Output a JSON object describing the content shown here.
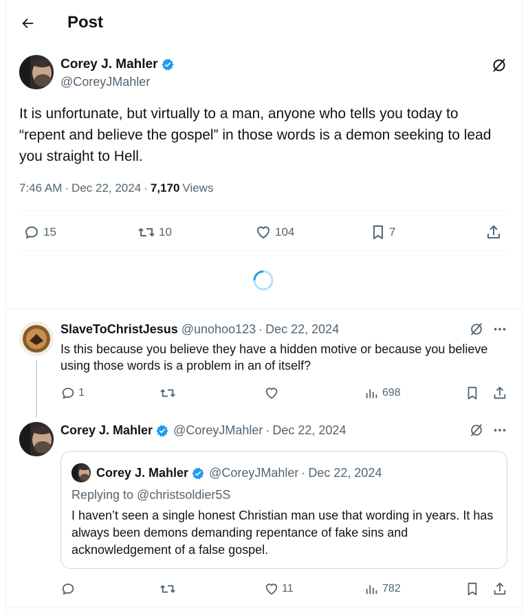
{
  "header": {
    "title": "Post"
  },
  "main_post": {
    "author": {
      "name": "Corey J. Mahler",
      "handle": "@CoreyJMahler"
    },
    "text": "It is unfortunate, but virtually to a man, anyone who tells you today to “repent and believe the gospel” in those words is a demon seeking to lead you straight to Hell.",
    "time": "7:46 AM",
    "date": "Dec 22, 2024",
    "views_count": "7,170",
    "views_label": "Views",
    "stats": {
      "replies": "15",
      "reposts": "10",
      "likes": "104",
      "bookmarks": "7"
    }
  },
  "reply1": {
    "author": {
      "name": "SlaveToChristJesus",
      "handle": "@unohoo123"
    },
    "date": "Dec 22, 2024",
    "text": "Is this because you believe they have a hidden motive or because you believe using those words is a problem in an of itself?",
    "stats": {
      "replies": "1",
      "views": "698"
    }
  },
  "reply2": {
    "author": {
      "name": "Corey J. Mahler",
      "handle": "@CoreyJMahler"
    },
    "date": "Dec 22, 2024",
    "quote": {
      "author": {
        "name": "Corey J. Mahler",
        "handle": "@CoreyJMahler"
      },
      "date": "Dec 22, 2024",
      "replying_to": "Replying to @christsoldier5S",
      "text": "I haven’t seen a single honest Christian man use that wording in years. It has always been demons demanding repentance of fake sins and acknowledgement of a false gospel."
    },
    "stats": {
      "likes": "11",
      "views": "782"
    }
  },
  "dot_separator": "·",
  "colors": {
    "blue": "#1d9bf0",
    "gray": "#536471",
    "border": "#eff3f4"
  },
  "icons": [
    "back-arrow-icon",
    "verified-icon",
    "grok-icon",
    "more-icon",
    "reply-icon",
    "repost-icon",
    "like-icon",
    "bookmark-icon",
    "share-icon",
    "views-icon",
    "loading-spinner"
  ]
}
